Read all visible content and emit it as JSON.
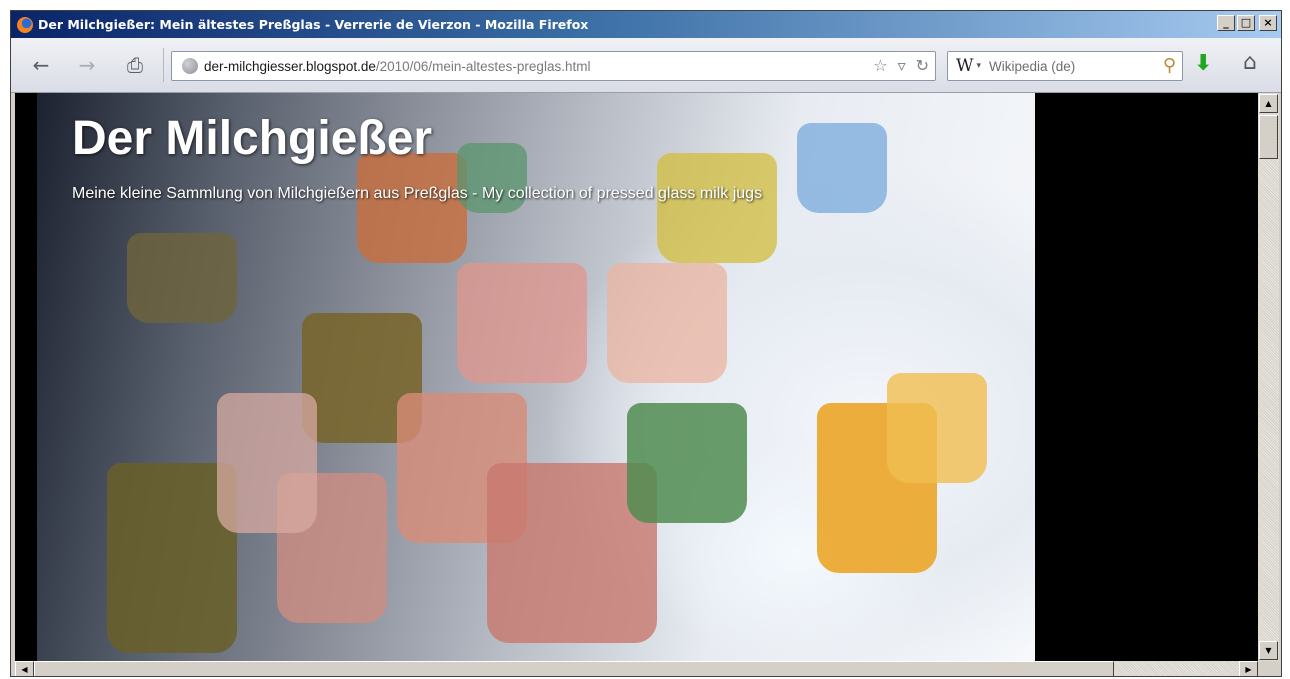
{
  "window": {
    "title": "Der Milchgießer: Mein ältestes Preßglas - Verrerie de Vierzon - Mozilla Firefox",
    "minimize_label": "_",
    "maximize_label": "□",
    "close_label": "×"
  },
  "toolbar": {
    "back_icon": "←",
    "forward_icon": "→",
    "print_icon": "⎙",
    "url_domain": "der-milchgiesser.blogspot.de",
    "url_path": "/2010/06/mein-altestes-preglas.html",
    "bookmark_star_icon": "☆",
    "history_dropdown_icon": "▿",
    "reload_icon": "↻",
    "search_engine_icon": "W",
    "search_engine_dropdown_icon": "▾",
    "search_placeholder": "Wikipedia (de)",
    "search_go_icon": "⚲",
    "download_icon": "⬇",
    "home_icon": "⌂"
  },
  "blog": {
    "title": "Der Milchgießer",
    "description": "Meine kleine Sammlung von Milchgießern aus Preßglas - My collection of pressed glass milk jugs"
  },
  "scrollbars": {
    "up_arrow": "▲",
    "down_arrow": "▼",
    "left_arrow": "◀",
    "right_arrow": "▶"
  },
  "colors": {
    "titlebar_start": "#0a246a",
    "titlebar_end": "#a6caf0",
    "content_background": "#000000",
    "download_green": "#22a522"
  }
}
